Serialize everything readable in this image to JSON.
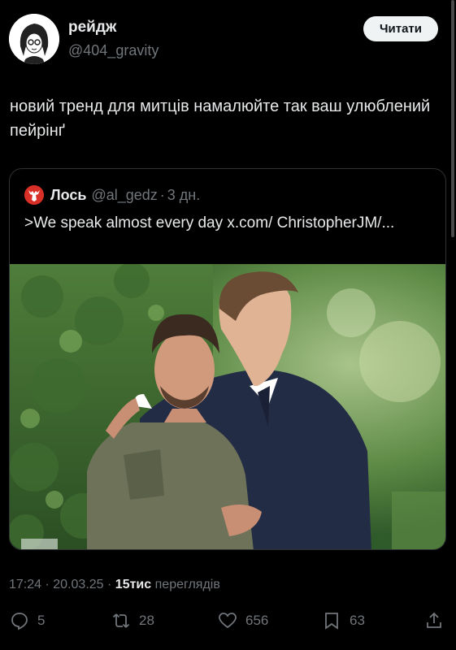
{
  "author": {
    "display_name": "рейдж",
    "handle": "@404_gravity",
    "avatar_icon": "avatar-drawing-icon"
  },
  "follow_button": {
    "label": "Читати"
  },
  "post": {
    "text": "новий тренд для митців намалюйте так ваш улюблений пейрінґ"
  },
  "quote": {
    "display_name": "Лось",
    "handle": "@al_gedz",
    "separator": "·",
    "time": "3 дн.",
    "text": ">We speak almost every day x.com/ ChristopherJM/...",
    "avatar_icon": "moose-avatar-icon"
  },
  "meta": {
    "time": "17:24",
    "date": "20.03.25",
    "views_count": "15тис",
    "views_label": "переглядів"
  },
  "actions": {
    "replies": "5",
    "reposts": "28",
    "likes": "656",
    "bookmarks": "63"
  },
  "colors": {
    "background": "#000000",
    "text": "#e7e9ea",
    "muted": "#71767b",
    "border": "#2f3336",
    "button_bg": "#eff3f4"
  }
}
